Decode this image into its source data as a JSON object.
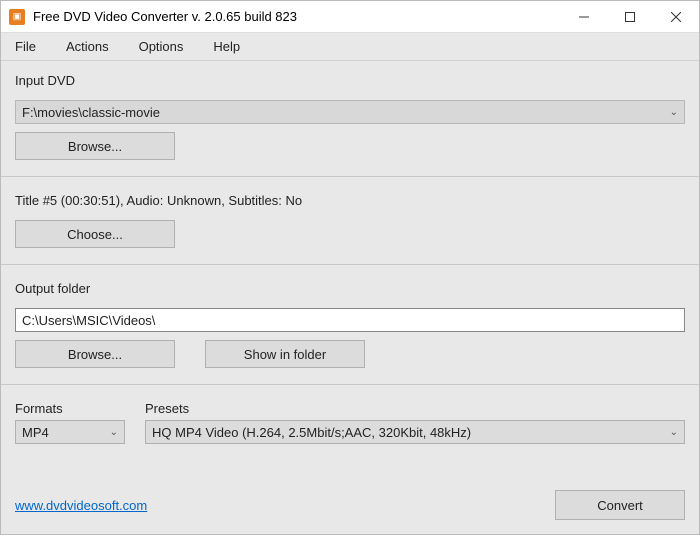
{
  "titlebar": {
    "title": "Free DVD Video Converter  v. 2.0.65 build 823"
  },
  "menubar": {
    "file": "File",
    "actions": "Actions",
    "options": "Options",
    "help": "Help"
  },
  "input_dvd": {
    "label": "Input DVD",
    "value": "F:\\movies\\classic-movie",
    "browse": "Browse..."
  },
  "title_info": {
    "summary": "Title #5 (00:30:51), Audio: Unknown, Subtitles: No",
    "choose": "Choose..."
  },
  "output": {
    "label": "Output folder",
    "value": "C:\\Users\\MSIC\\Videos\\",
    "browse": "Browse...",
    "show_in_folder": "Show in folder"
  },
  "formats": {
    "label": "Formats",
    "value": "MP4"
  },
  "presets": {
    "label": "Presets",
    "value": "HQ MP4 Video (H.264, 2.5Mbit/s;AAC, 320Kbit, 48kHz)"
  },
  "footer": {
    "link": "www.dvdvideosoft.com",
    "convert": "Convert"
  }
}
